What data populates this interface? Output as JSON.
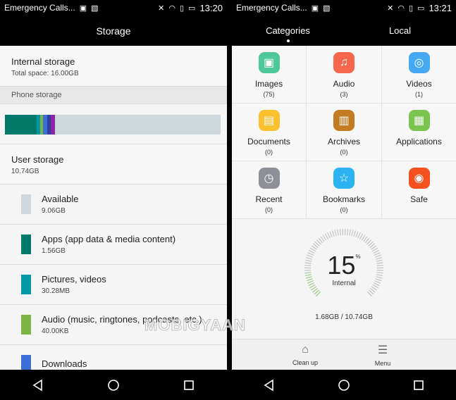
{
  "left": {
    "status": {
      "carrier": "Emergency Calls...",
      "time": "13:20"
    },
    "title": "Storage",
    "internal": {
      "title": "Internal storage",
      "subtitle": "Total space: 16.00GB"
    },
    "section": "Phone storage",
    "bar_segments": [
      {
        "color": "#00796b",
        "pct": 14.6
      },
      {
        "color": "#0097a7",
        "pct": 1.6
      },
      {
        "color": "#7cb342",
        "pct": 1.6
      },
      {
        "color": "#3b6fd6",
        "pct": 1.8
      },
      {
        "color": "#303f9f",
        "pct": 1.8
      },
      {
        "color": "#8e24aa",
        "pct": 1.8
      }
    ],
    "user": {
      "title": "User storage",
      "subtitle": "10.74GB"
    },
    "items": [
      {
        "label": "Available",
        "size": "9.06GB",
        "color": "#cfd8dc"
      },
      {
        "label": "Apps (app data & media content)",
        "size": "1.56GB",
        "color": "#00796b"
      },
      {
        "label": "Pictures, videos",
        "size": "30.28MB",
        "color": "#0097a7"
      },
      {
        "label": "Audio (music, ringtones, podcasts, etc.)",
        "size": "40.00KB",
        "color": "#7cb342"
      },
      {
        "label": "Downloads",
        "size": "",
        "color": "#3b6fd6"
      }
    ]
  },
  "right": {
    "status": {
      "carrier": "Emergency Calls...",
      "time": "13:21"
    },
    "tabs": [
      "Categories",
      "Local"
    ],
    "categories": [
      {
        "label": "Images",
        "count": "(75)",
        "color": "#4ec79a",
        "icon": "image-icon",
        "glyph": "▣"
      },
      {
        "label": "Audio",
        "count": "(3)",
        "color": "#f5664b",
        "icon": "music-icon",
        "glyph": "♫"
      },
      {
        "label": "Videos",
        "count": "(1)",
        "color": "#45a8f0",
        "icon": "film-reel-icon",
        "glyph": "◎"
      },
      {
        "label": "Documents",
        "count": "(0)",
        "color": "#fbc02d",
        "icon": "document-icon",
        "glyph": "▤"
      },
      {
        "label": "Archives",
        "count": "(0)",
        "color": "#c47a22",
        "icon": "archive-icon",
        "glyph": "▥"
      },
      {
        "label": "Applications",
        "count": "",
        "color": "#7ac44f",
        "icon": "apps-grid-icon",
        "glyph": "▦"
      },
      {
        "label": "Recent",
        "count": "(0)",
        "color": "#8d9096",
        "icon": "clock-icon",
        "glyph": "◷"
      },
      {
        "label": "Bookmarks",
        "count": "(0)",
        "color": "#2bb3f2",
        "icon": "star-icon",
        "glyph": "☆"
      },
      {
        "label": "Safe",
        "count": "",
        "color": "#f4511e",
        "icon": "safe-icon",
        "glyph": "◉"
      }
    ],
    "gauge": {
      "value": "15",
      "unit": "%",
      "label": "Internal",
      "usage": "1.68GB / 10.74GB",
      "percent": 15
    },
    "bottom": {
      "cleanup": "Clean up",
      "menu": "Menu"
    }
  },
  "watermark": "MOBIGYAAN"
}
